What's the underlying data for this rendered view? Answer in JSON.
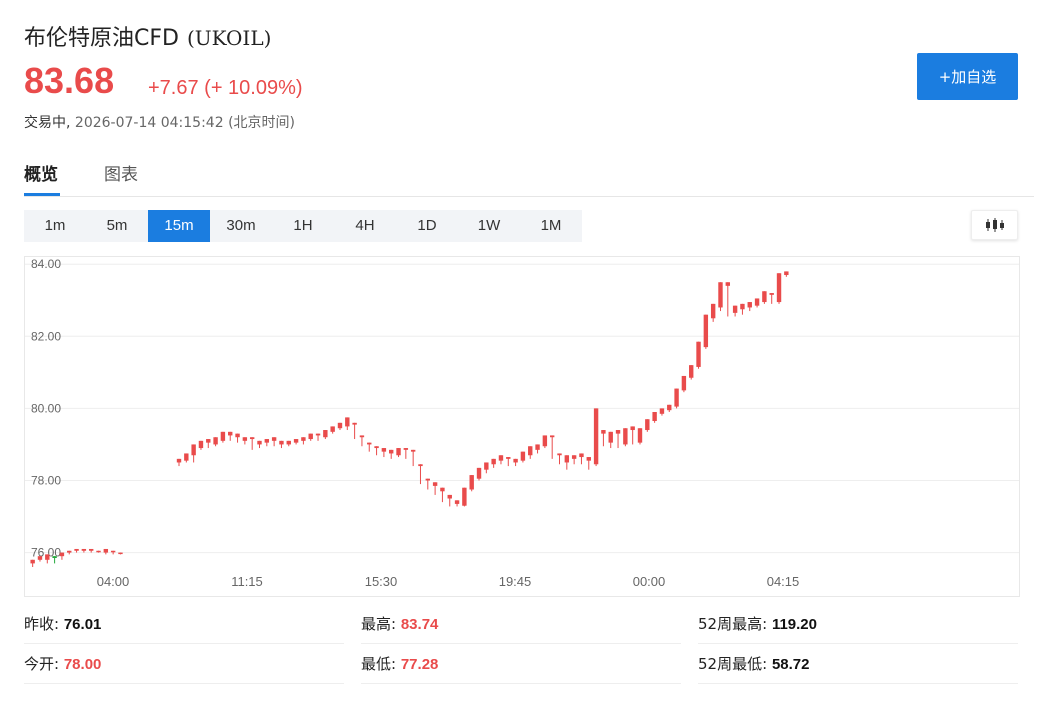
{
  "header": {
    "name": "布伦特原油CFD",
    "code": "(UKOIL)",
    "price": "83.68",
    "change": "+7.67 (+ 10.09%)",
    "status_label": "交易中,",
    "timestamp": "2026-07-14 04:15:42",
    "timezone": "(北京时间)",
    "add_button": "+加自选"
  },
  "tabs": [
    {
      "label": "概览",
      "active": true
    },
    {
      "label": "图表",
      "active": false
    }
  ],
  "intervals": [
    {
      "label": "1m",
      "active": false
    },
    {
      "label": "5m",
      "active": false
    },
    {
      "label": "15m",
      "active": true
    },
    {
      "label": "30m",
      "active": false
    },
    {
      "label": "1H",
      "active": false
    },
    {
      "label": "4H",
      "active": false
    },
    {
      "label": "1D",
      "active": false
    },
    {
      "label": "1W",
      "active": false
    },
    {
      "label": "1M",
      "active": false
    }
  ],
  "colors": {
    "up": "#e94b4b",
    "down": "#22a83b",
    "accent": "#1b7de0",
    "grid": "#eeeeee",
    "axis_text": "#666666"
  },
  "chart_data": {
    "type": "candlestick",
    "yticks": [
      "84.00",
      "82.00",
      "80.00",
      "78.00",
      "76.00"
    ],
    "ylim": [
      75.6,
      84.2
    ],
    "xticks": [
      "04:00",
      "11:15",
      "15:30",
      "19:45",
      "00:00",
      "04:15"
    ],
    "grid": true,
    "candles": [
      [
        75.7,
        75.8,
        75.6,
        75.8
      ],
      [
        75.8,
        75.9,
        75.75,
        75.8
      ],
      [
        75.8,
        75.95,
        75.7,
        75.9
      ],
      [
        75.9,
        75.85,
        75.7,
        75.75
      ],
      [
        75.9,
        76.0,
        75.8,
        75.95
      ],
      [
        76.0,
        76.05,
        75.95,
        76.0
      ],
      [
        76.05,
        76.1,
        76.0,
        76.05
      ],
      [
        76.05,
        76.1,
        76.0,
        76.1
      ],
      [
        76.05,
        76.1,
        76.0,
        76.05
      ],
      [
        76.05,
        76.05,
        76.0,
        76.0
      ],
      [
        76.0,
        76.1,
        75.95,
        76.0
      ],
      [
        76.05,
        76.05,
        75.95,
        75.95
      ],
      [
        76.0,
        76.0,
        75.95,
        75.95
      ],
      [
        78.5,
        78.6,
        78.4,
        78.55
      ],
      [
        78.55,
        78.75,
        78.5,
        78.7
      ],
      [
        78.7,
        79.0,
        78.5,
        78.9
      ],
      [
        78.9,
        79.1,
        78.85,
        79.05
      ],
      [
        79.05,
        79.15,
        78.9,
        79.0
      ],
      [
        79.0,
        79.2,
        78.95,
        79.15
      ],
      [
        79.1,
        79.35,
        79.05,
        79.3
      ],
      [
        79.25,
        79.35,
        79.1,
        79.2
      ],
      [
        79.2,
        79.3,
        79.05,
        79.1
      ],
      [
        79.1,
        79.2,
        79.0,
        79.15
      ],
      [
        79.15,
        79.2,
        78.85,
        79.0
      ],
      [
        79.0,
        79.1,
        78.9,
        79.05
      ],
      [
        79.05,
        79.15,
        78.95,
        79.1
      ],
      [
        79.1,
        79.2,
        78.95,
        79.05
      ],
      [
        79.0,
        79.1,
        78.9,
        79.0
      ],
      [
        79.0,
        79.1,
        78.95,
        79.05
      ],
      [
        79.05,
        79.15,
        79.0,
        79.1
      ],
      [
        79.1,
        79.2,
        79.0,
        79.15
      ],
      [
        79.15,
        79.3,
        79.1,
        79.25
      ],
      [
        79.25,
        79.3,
        79.1,
        79.2
      ],
      [
        79.2,
        79.4,
        79.15,
        79.35
      ],
      [
        79.35,
        79.5,
        79.3,
        79.45
      ],
      [
        79.45,
        79.6,
        79.4,
        79.5
      ],
      [
        79.5,
        79.75,
        79.4,
        79.7
      ],
      [
        79.55,
        79.6,
        79.15,
        79.25
      ],
      [
        79.2,
        79.25,
        78.95,
        79.0
      ],
      [
        79.0,
        79.05,
        78.8,
        78.9
      ],
      [
        78.9,
        78.95,
        78.7,
        78.8
      ],
      [
        78.8,
        78.9,
        78.65,
        78.75
      ],
      [
        78.75,
        78.85,
        78.6,
        78.7
      ],
      [
        78.7,
        78.9,
        78.65,
        78.85
      ],
      [
        78.85,
        78.9,
        78.6,
        78.7
      ],
      [
        78.8,
        78.85,
        78.4,
        78.5
      ],
      [
        78.4,
        78.45,
        77.9,
        78.0
      ],
      [
        78.0,
        78.05,
        77.75,
        77.85
      ],
      [
        77.85,
        77.95,
        77.6,
        77.7
      ],
      [
        77.7,
        77.8,
        77.4,
        77.5
      ],
      [
        77.5,
        77.6,
        77.28,
        77.35
      ],
      [
        77.35,
        77.45,
        77.28,
        77.3
      ],
      [
        77.3,
        77.8,
        77.28,
        77.75
      ],
      [
        77.75,
        78.15,
        77.7,
        78.05
      ],
      [
        78.05,
        78.35,
        78.0,
        78.3
      ],
      [
        78.3,
        78.5,
        78.2,
        78.45
      ],
      [
        78.45,
        78.6,
        78.35,
        78.55
      ],
      [
        78.55,
        78.7,
        78.45,
        78.6
      ],
      [
        78.6,
        78.65,
        78.4,
        78.5
      ],
      [
        78.5,
        78.6,
        78.4,
        78.55
      ],
      [
        78.55,
        78.8,
        78.5,
        78.7
      ],
      [
        78.7,
        78.95,
        78.6,
        78.85
      ],
      [
        78.85,
        79.0,
        78.75,
        78.95
      ],
      [
        78.95,
        79.25,
        78.9,
        79.2
      ],
      [
        79.2,
        79.25,
        78.6,
        78.7
      ],
      [
        78.7,
        78.75,
        78.45,
        78.5
      ],
      [
        78.5,
        78.7,
        78.3,
        78.6
      ],
      [
        78.6,
        78.7,
        78.45,
        78.65
      ],
      [
        78.65,
        78.75,
        78.45,
        78.55
      ],
      [
        78.55,
        78.65,
        78.3,
        78.45
      ],
      [
        78.45,
        80.0,
        78.4,
        79.3
      ],
      [
        79.3,
        79.4,
        78.95,
        79.05
      ],
      [
        79.05,
        79.35,
        78.9,
        79.3
      ],
      [
        79.3,
        79.4,
        78.9,
        79.0
      ],
      [
        79.0,
        79.45,
        78.95,
        79.4
      ],
      [
        79.4,
        79.5,
        79.0,
        79.05
      ],
      [
        79.05,
        79.45,
        79.0,
        79.4
      ],
      [
        79.4,
        79.7,
        79.35,
        79.65
      ],
      [
        79.65,
        79.9,
        79.6,
        79.85
      ],
      [
        79.85,
        80.0,
        79.8,
        79.95
      ],
      [
        79.95,
        80.1,
        79.9,
        80.05
      ],
      [
        80.05,
        80.55,
        80.0,
        80.5
      ],
      [
        80.5,
        80.9,
        80.45,
        80.85
      ],
      [
        80.85,
        81.2,
        80.8,
        81.15
      ],
      [
        81.15,
        81.85,
        81.1,
        81.7
      ],
      [
        81.7,
        82.6,
        81.65,
        82.5
      ],
      [
        82.5,
        82.9,
        82.4,
        82.8
      ],
      [
        82.8,
        83.5,
        82.7,
        83.4
      ],
      [
        83.4,
        83.5,
        82.55,
        82.65
      ],
      [
        82.65,
        82.85,
        82.55,
        82.75
      ],
      [
        82.75,
        82.9,
        82.6,
        82.8
      ],
      [
        82.8,
        82.95,
        82.7,
        82.85
      ],
      [
        82.85,
        83.05,
        82.8,
        82.95
      ],
      [
        82.95,
        83.25,
        82.9,
        83.15
      ],
      [
        83.15,
        83.2,
        82.9,
        82.95
      ],
      [
        82.95,
        83.75,
        82.9,
        83.7
      ],
      [
        83.7,
        83.8,
        83.65,
        83.74
      ]
    ]
  },
  "stats": {
    "prev_close_label": "昨收:",
    "prev_close": "76.01",
    "open_label": "今开:",
    "open": "78.00",
    "high_label": "最高:",
    "high": "83.74",
    "low_label": "最低:",
    "low": "77.28",
    "wk52_high_label": "52周最高:",
    "wk52_high": "119.20",
    "wk52_low_label": "52周最低:",
    "wk52_low": "58.72"
  }
}
